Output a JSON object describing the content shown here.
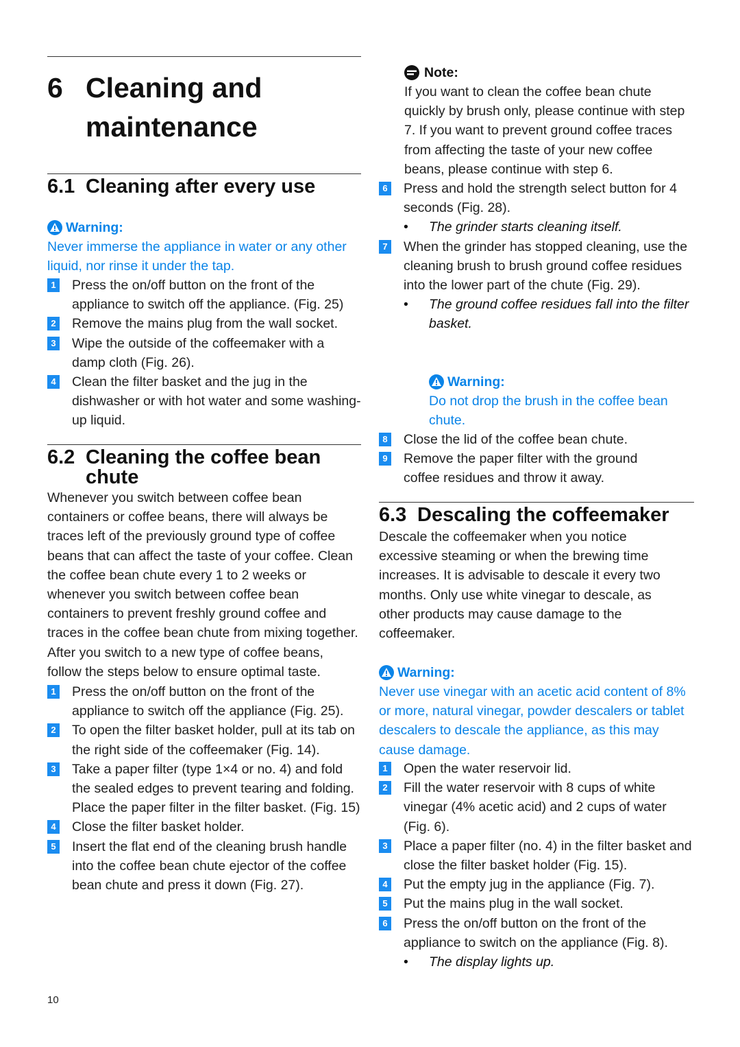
{
  "chapter": {
    "number": "6",
    "title_line1": "Cleaning and",
    "title_line2": "maintenance"
  },
  "section_6_1": {
    "number": "6.1",
    "title": "Cleaning after every use",
    "warning": {
      "icon": "warning-triangle-icon",
      "title": "Warning:",
      "text": "Never immerse the appliance in water or any other liquid, nor rinse it under the tap."
    },
    "steps": [
      {
        "n": "1",
        "text": "Press the on/off button on the front of the appliance to switch off the appliance.  (Fig. 25)"
      },
      {
        "n": "2",
        "text": "Remove the mains plug from the wall socket."
      },
      {
        "n": "3",
        "text": "Wipe the outside of the coffeemaker with a damp cloth (Fig. 26)."
      },
      {
        "n": "4",
        "text": "Clean the filter basket and the jug in the dishwasher or with hot water and some washing-up liquid."
      }
    ]
  },
  "section_6_2": {
    "number": "6.2",
    "title": "Cleaning the coffee bean chute",
    "intro": "Whenever you switch between coffee bean containers or coffee beans, there will always be traces left of the previously ground type of coffee beans that can affect the taste of your coffee. Clean the coffee bean chute every 1 to 2 weeks or whenever you switch between coffee bean containers to prevent freshly ground coffee and traces in the coffee bean chute from mixing together. After you switch to a new type of coffee beans, follow the steps below to ensure optimal taste.",
    "steps": [
      {
        "n": "1",
        "text": "Press the on/off button on the front of the appliance to switch off the appliance (Fig. 25)."
      },
      {
        "n": "2",
        "text": "To open the filter basket holder, pull at its tab on the right side of the coffeemaker (Fig. 14)."
      },
      {
        "n": "3",
        "text": "Take a paper filter (type 1×4 or no. 4) and fold the sealed edges to prevent tearing and folding. Place the paper filter in the filter basket.  (Fig. 15)"
      },
      {
        "n": "4",
        "text": "Close the filter basket holder."
      },
      {
        "n": "5",
        "text": "Insert the flat end of the cleaning brush handle into the coffee bean chute ejector of the coffee bean chute and press it down (Fig. 27)."
      }
    ],
    "note": {
      "icon": "note-icon",
      "title": "Note:",
      "text": "If you want to clean the coffee bean chute quickly by brush only, please continue with step 7. If you want to prevent ground coffee traces from affecting the taste of your new coffee beans, please continue with step 6."
    },
    "steps_cont": [
      {
        "n": "6",
        "text": "Press and hold the strength select button for 4 seconds (Fig. 28).",
        "bullet": "The grinder starts cleaning itself."
      },
      {
        "n": "7",
        "text": "When the grinder has stopped cleaning, use the cleaning brush to brush ground coffee residues into the lower part of the chute (Fig. 29).",
        "bullet": "The ground coffee residues fall into the filter basket."
      }
    ],
    "warning": {
      "icon": "warning-triangle-icon",
      "title": "Warning:",
      "text": "Do not drop the brush in the coffee bean chute."
    },
    "steps_end": [
      {
        "n": "8",
        "text": "Close the lid of the coffee bean chute."
      },
      {
        "n": "9",
        "text": "Remove the paper filter with the ground coffee residues and throw it away."
      }
    ]
  },
  "section_6_3": {
    "number": "6.3",
    "title": "Descaling the coffeemaker",
    "intro": "Descale the coffeemaker when you notice excessive steaming or when the brewing time increases. It is advisable to descale it every two months. Only use white vinegar to descale, as other products may cause damage to the coffeemaker.",
    "warning": {
      "icon": "warning-triangle-icon",
      "title": "Warning:",
      "text": "Never use vinegar with an acetic acid content of 8% or more, natural vinegar, powder descalers or tablet descalers to descale the appliance, as this may cause damage."
    },
    "steps": [
      {
        "n": "1",
        "text": "Open the water reservoir lid."
      },
      {
        "n": "2",
        "text": "Fill the water reservoir with 8 cups of white vinegar (4% acetic acid) and 2 cups of water (Fig. 6)."
      },
      {
        "n": "3",
        "text": "Place a paper filter (no. 4) in the filter basket and close the filter basket holder (Fig. 15)."
      },
      {
        "n": "4",
        "text": "Put the empty jug in the appliance (Fig. 7)."
      },
      {
        "n": "5",
        "text": "Put the mains plug in the wall socket."
      },
      {
        "n": "6",
        "text": "Press the on/off button on the front of the appliance to switch on the appliance (Fig. 8).",
        "bullet": "The display lights up."
      }
    ]
  },
  "colors": {
    "accent_blue": "#0a84e8",
    "badge_blue": "#1a8cf0",
    "text": "#222222"
  },
  "page_number": "10"
}
